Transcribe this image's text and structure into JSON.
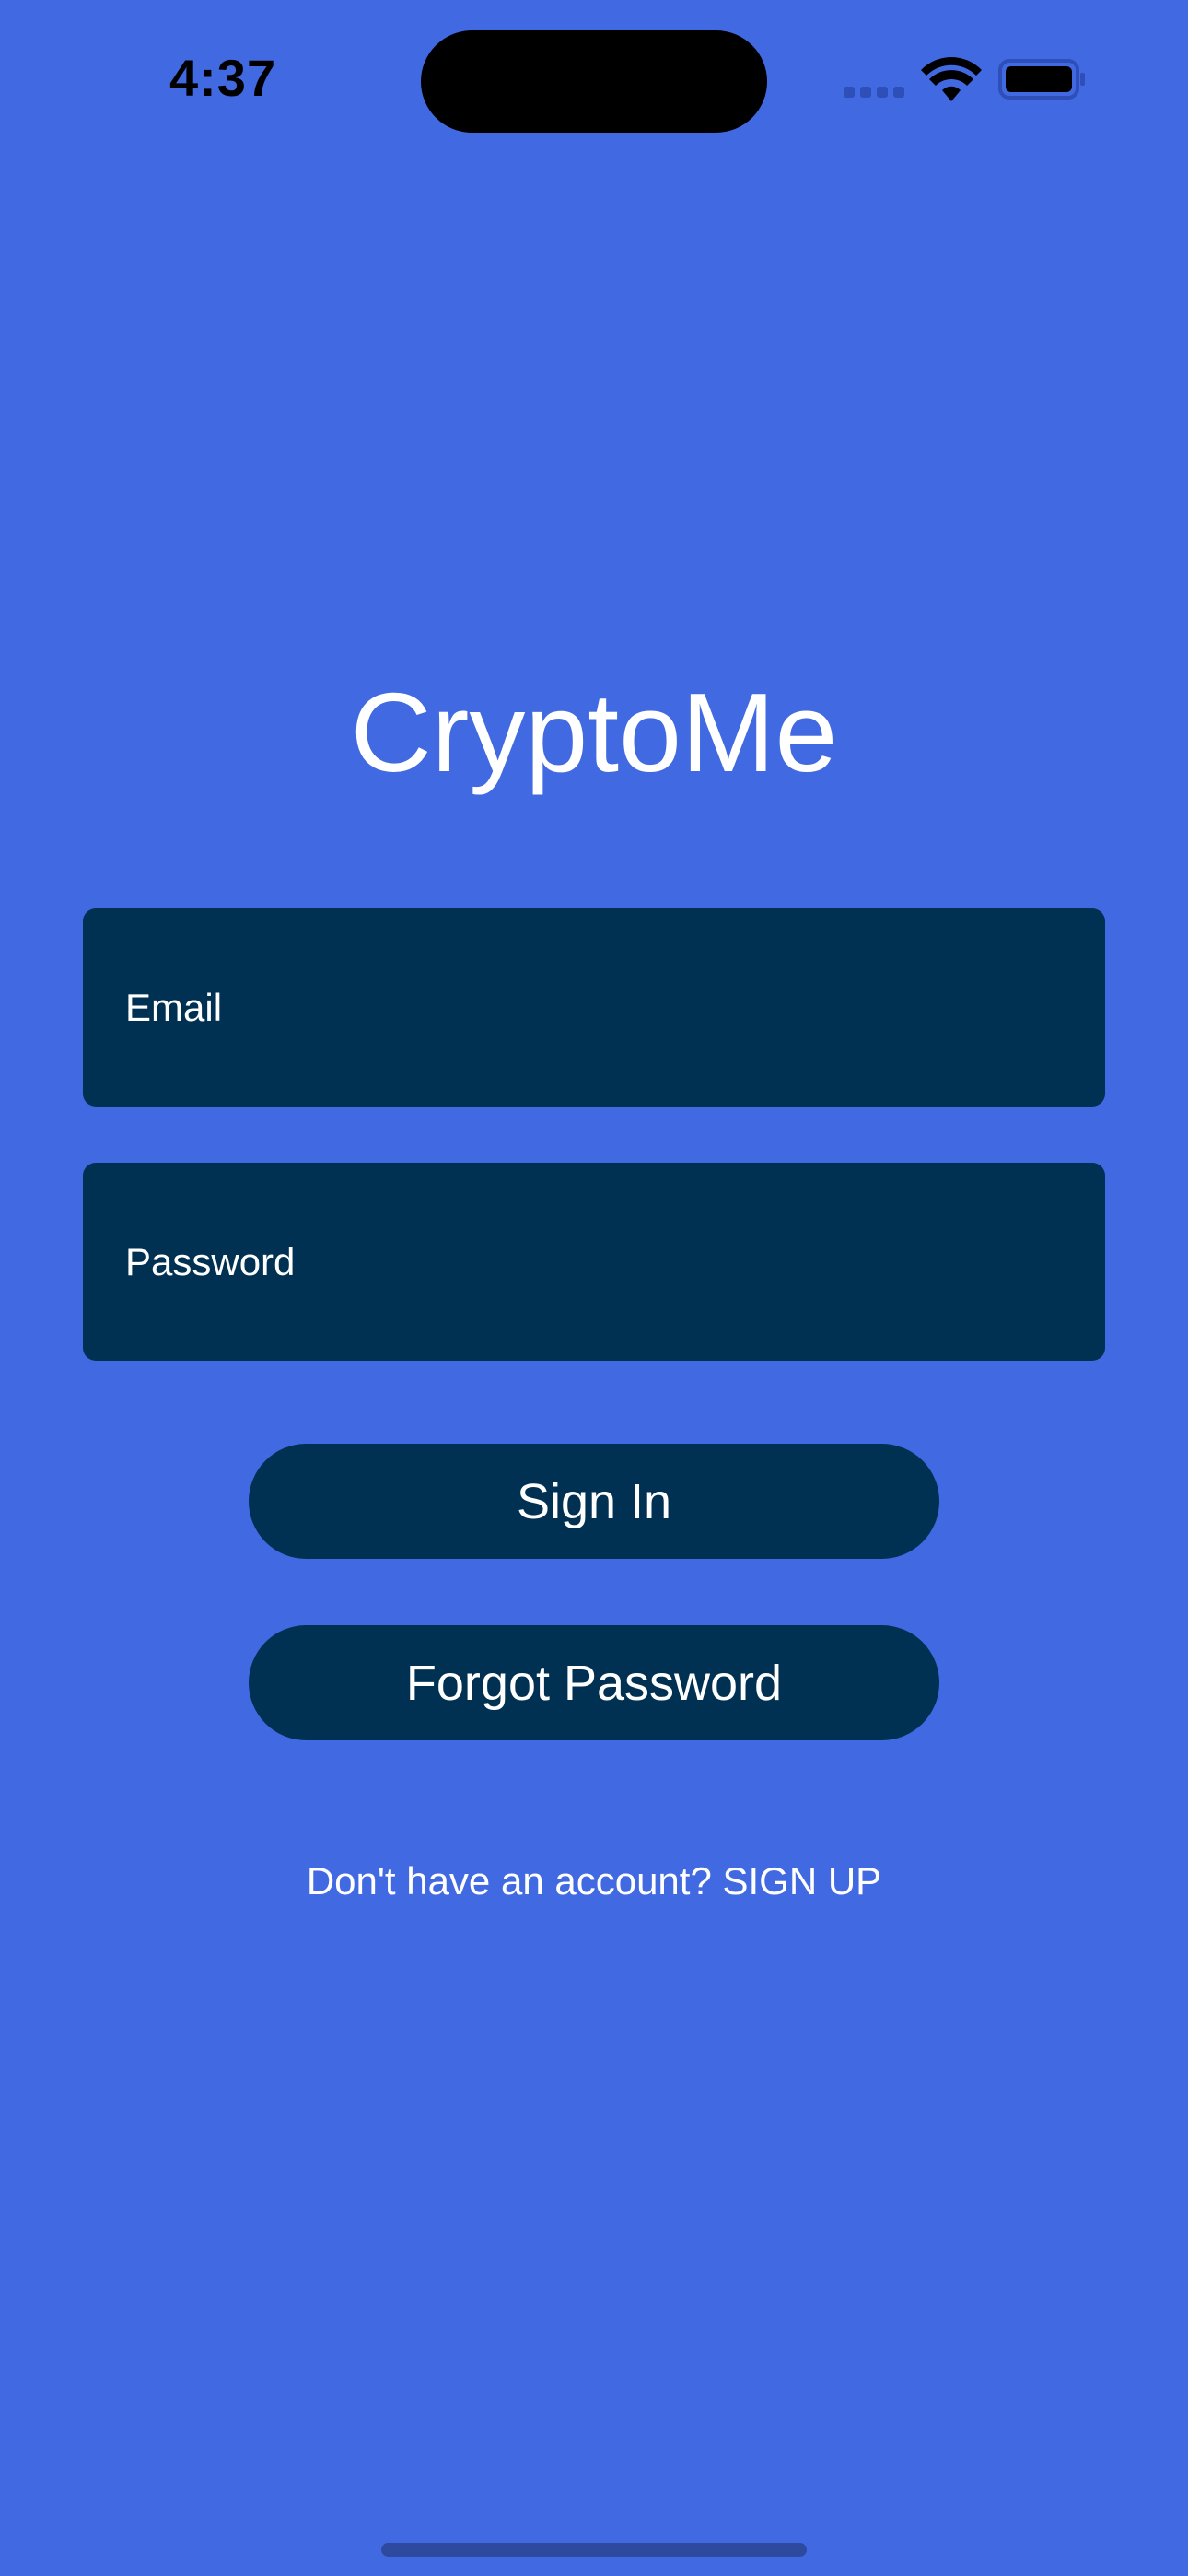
{
  "status_bar": {
    "time": "4:37"
  },
  "app": {
    "title": "CryptoMe"
  },
  "form": {
    "email_placeholder": "Email",
    "password_placeholder": "Password",
    "sign_in_label": "Sign In",
    "forgot_password_label": "Forgot Password",
    "signup_prompt": "Don't have an account? SIGN UP"
  },
  "colors": {
    "background": "#4169E1",
    "field_fill": "#003153",
    "text": "#FFFFFF"
  },
  "icons": [
    "cellular-signal-icon",
    "wifi-icon",
    "battery-icon"
  ]
}
